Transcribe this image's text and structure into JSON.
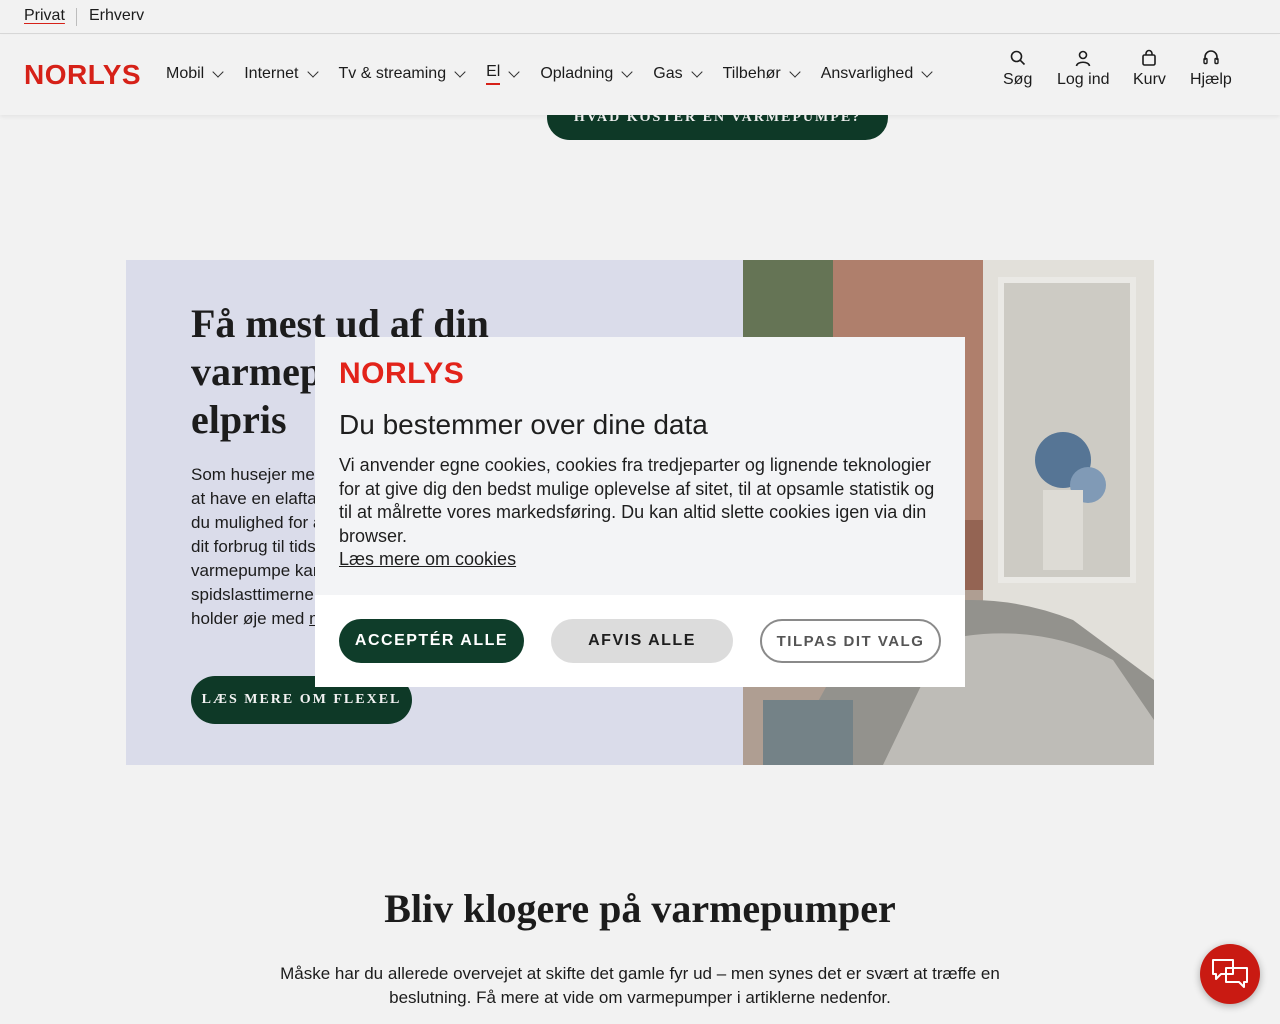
{
  "topbar": {
    "privat": "Privat",
    "erhverv": "Erhverv"
  },
  "brand": {
    "logo": "NORLYS",
    "color": "#e2231a"
  },
  "nav": [
    {
      "label": "Mobil"
    },
    {
      "label": "Internet"
    },
    {
      "label": "Tv & streaming"
    },
    {
      "label": "El",
      "active": true
    },
    {
      "label": "Opladning"
    },
    {
      "label": "Gas"
    },
    {
      "label": "Tilbehør"
    },
    {
      "label": "Ansvarlighed"
    }
  ],
  "utility": {
    "search": "Søg",
    "login": "Log ind",
    "cart": "Kurv",
    "help": "Hjælp"
  },
  "page": {
    "top_button": "HVAD KOSTER EN VARMEPUMPE?",
    "feature": {
      "title": "Få mest ud af din varmepumpe med variabel elpris",
      "body": "Som husejer med varmepumpe kan du spare penge ved at have en elaftale med variable elpriser. Med FlexEl har du mulighed for at følge de skiftende timepriser og flytte dit forbrug til tidspunkter, hvor strømmen er billigst. Din varmepumpe kan eventuelt indstilles til ikke at køre i spidslasttimerne. I den forbindelse anbefaler vi, at du også holder øje med",
      "link": "netselskabernes",
      "cta": "LÆS MERE OM FLEXEL"
    },
    "section_title": "Bliv klogere på varmepumper",
    "section_text": "Måske har du allerede overvejet at skifte det gamle fyr ud – men synes det er svært at træffe en beslutning. Få mere at vide om varmepumper i artiklerne nedenfor."
  },
  "cookie_modal": {
    "logo": "NORLYS",
    "title": "Du bestemmer over dine data",
    "text": "Vi anvender egne cookies, cookies fra tredjeparter og lignende teknologier for at give dig den bedst mulige oplevelse af sitet, til at opsamle statistik og til at målrette vores markedsføring. Du kan altid slette cookies igen via din browser.",
    "link": "Læs mere om cookies",
    "accept": "ACCEPTÉR ALLE",
    "reject": "AFVIS ALLE",
    "customize": "TILPAS DIT VALG"
  },
  "colors": {
    "dark_green": "#0f3d2a",
    "brand_red": "#e2231a",
    "chat_red": "#c91a12"
  },
  "icons": {
    "search": "search-icon",
    "login": "user-icon",
    "cart": "bag-icon",
    "help": "headset-icon",
    "chat": "chat-bubbles-icon"
  }
}
